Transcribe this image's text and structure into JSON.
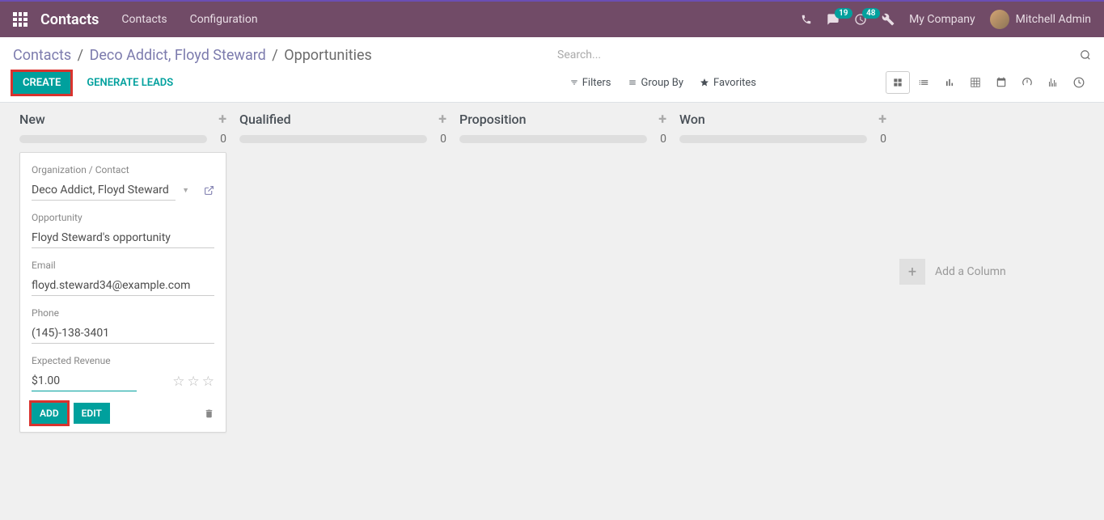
{
  "topbar": {
    "brand": "Contacts",
    "nav": {
      "contacts": "Contacts",
      "configuration": "Configuration"
    },
    "badges": {
      "discuss": "19",
      "activities": "48"
    },
    "company": "My Company",
    "user": "Mitchell Admin"
  },
  "breadcrumb": {
    "root": "Contacts",
    "parent": "Deco Addict, Floyd Steward",
    "current": "Opportunities"
  },
  "search": {
    "placeholder": "Search..."
  },
  "actions": {
    "create": "CREATE",
    "generate_leads": "GENERATE LEADS"
  },
  "filters": {
    "filters": "Filters",
    "groupby": "Group By",
    "favorites": "Favorites"
  },
  "columns": [
    {
      "title": "New",
      "count": "0"
    },
    {
      "title": "Qualified",
      "count": "0"
    },
    {
      "title": "Proposition",
      "count": "0"
    },
    {
      "title": "Won",
      "count": "0"
    }
  ],
  "add_column": "Add a Column",
  "card": {
    "labels": {
      "org": "Organization / Contact",
      "opportunity": "Opportunity",
      "email": "Email",
      "phone": "Phone",
      "revenue": "Expected Revenue"
    },
    "values": {
      "org": "Deco Addict, Floyd Steward",
      "opportunity": "Floyd Steward's opportunity",
      "email": "floyd.steward34@example.com",
      "phone": "(145)-138-3401",
      "revenue": "$1.00"
    },
    "buttons": {
      "add": "ADD",
      "edit": "EDIT"
    }
  }
}
